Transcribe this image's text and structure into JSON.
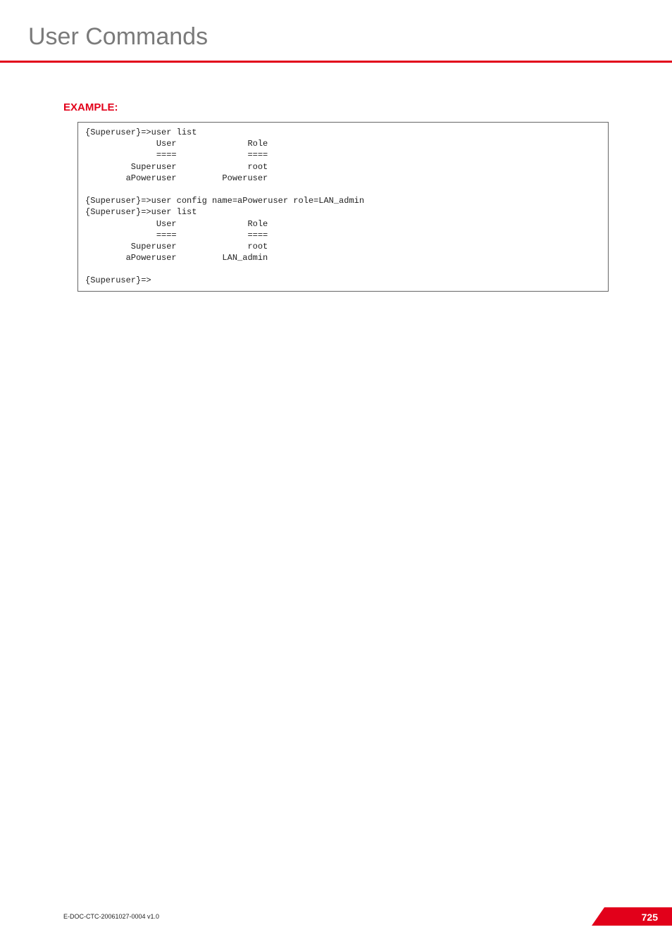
{
  "header": {
    "title": "User Commands"
  },
  "example": {
    "heading": "EXAMPLE:",
    "code": "{Superuser}=>user list\n              User              Role\n              ====              ====\n         Superuser              root\n        aPoweruser         Poweruser\n\n{Superuser}=>user config name=aPoweruser role=LAN_admin\n{Superuser}=>user list\n              User              Role\n              ====              ====\n         Superuser              root\n        aPoweruser         LAN_admin\n\n{Superuser}=>"
  },
  "footer": {
    "doc_id": "E-DOC-CTC-20061027-0004 v1.0",
    "page": "725"
  }
}
